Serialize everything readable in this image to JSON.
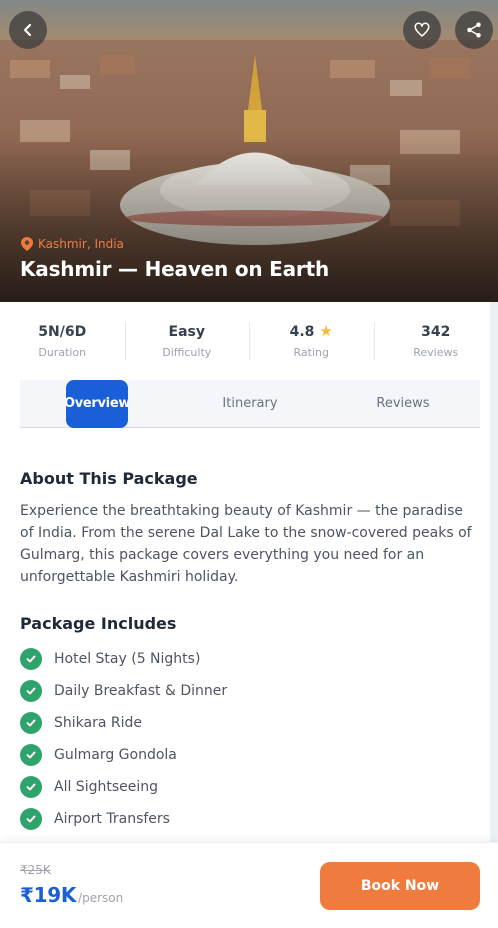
{
  "hero": {
    "location": "Kashmir, India",
    "title": "Kashmir — Heaven on Earth"
  },
  "stats": [
    {
      "value": "5N/6D",
      "label": "Duration"
    },
    {
      "value": "Easy",
      "label": "Difficulty"
    },
    {
      "value": "4.8",
      "label": "Rating",
      "icon": "star-icon"
    },
    {
      "value": "342",
      "label": "Reviews"
    }
  ],
  "tabs": [
    "Overview",
    "Itinerary",
    "Reviews"
  ],
  "about": {
    "heading": "About This Package",
    "text": "Experience the breathtaking beauty of Kashmir — the paradise of India. From the serene Dal Lake to the snow-covered peaks of Gulmarg, this package covers everything you need for an unforgettable Kashmiri holiday."
  },
  "includes": {
    "heading": "Package Includes",
    "items": [
      "Hotel Stay (5 Nights)",
      "Daily Breakfast & Dinner",
      "Shikara Ride",
      "Gulmarg Gondola",
      "All Sightseeing",
      "Airport Transfers"
    ]
  },
  "booking": {
    "old_price": "₹25K",
    "price": "₹19K",
    "per": "/person",
    "button": "Book Now"
  },
  "colors": {
    "primary": "#1a5fd8",
    "accent": "#f07b3f",
    "success": "#2ea36b"
  }
}
